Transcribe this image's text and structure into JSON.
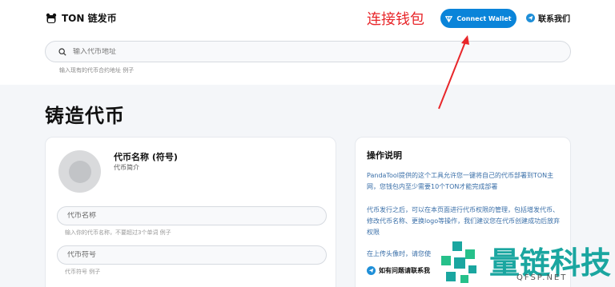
{
  "header": {
    "app_name": "TON 链发币",
    "connect_label": "Connect Wallet",
    "contact_label": "联系我们"
  },
  "annotation": {
    "text": "连接钱包"
  },
  "search": {
    "placeholder": "输入代币地址",
    "hint": "输入现有的代币合约地址 例子"
  },
  "page": {
    "title": "铸造代币"
  },
  "token_card": {
    "name": "代币名称 (符号)",
    "description": "代币简介",
    "fields": [
      {
        "placeholder": "代币名称",
        "hint": "输入你的代币名称，不要超过3个单词 例子"
      },
      {
        "placeholder": "代币符号",
        "hint": "代币符号 例子"
      }
    ]
  },
  "instructions": {
    "title": "操作说明",
    "paragraphs": [
      "PandaTool提供的这个工具允许您一键将自己的代币部署到TON主网，您钱包内至少需要10个TON才能完成部署",
      "代币发行之后，可以在本页面进行代币权限的管理，包括增发代币、修改代币名称、更换logo等操作，我们建议您在代币创建成功后放弃权限",
      "在上传头像时，请您使"
    ],
    "contact_label": "如有问题请联系我"
  },
  "watermark": {
    "text": "量链科技",
    "url": "QFSP.NET"
  },
  "colors": {
    "accent": "#0a84d9",
    "annotation": "#e8262a",
    "link_text": "#3a6fa8",
    "watermark": "#1aa6a0"
  }
}
